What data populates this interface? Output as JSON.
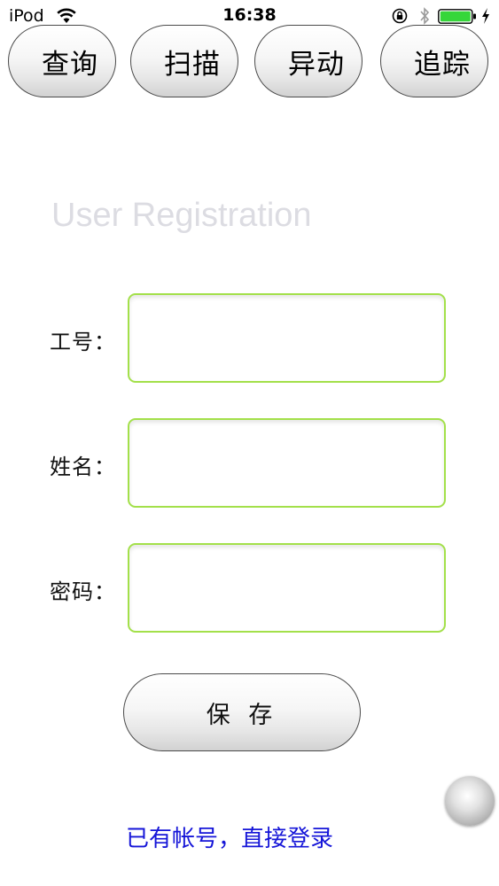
{
  "status_bar": {
    "carrier": "iPod",
    "time": "16:38",
    "battery_color": "#35d63a"
  },
  "top_nav": {
    "buttons": [
      {
        "label": "查询"
      },
      {
        "label": "扫描"
      },
      {
        "label": "异动"
      },
      {
        "label": "追踪"
      }
    ]
  },
  "form": {
    "title": "User Registration",
    "fields": [
      {
        "label": "工号：",
        "value": ""
      },
      {
        "label": "姓名：",
        "value": ""
      },
      {
        "label": "密码：",
        "value": ""
      }
    ],
    "field_border_color": "#a3e04a",
    "save_label": "保 存"
  },
  "login_link": {
    "label": "已有帐号，直接登录",
    "color": "#1515d8"
  },
  "icons": [
    "wifi-icon",
    "rotation-lock-icon",
    "bluetooth-icon",
    "battery-icon",
    "charging-icon",
    "assistive-touch-icon"
  ]
}
